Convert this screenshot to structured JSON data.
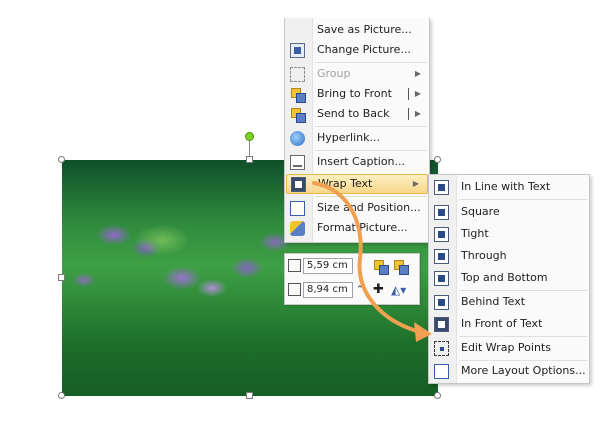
{
  "context_menu": {
    "items": [
      {
        "label": "Save as Picture...",
        "icon": "save-icon",
        "disabled": false
      },
      {
        "label": "Change Picture...",
        "icon": "change-picture-icon",
        "disabled": false
      },
      {
        "label": "Group",
        "icon": "group-icon",
        "disabled": true
      },
      {
        "label": "Bring to Front",
        "icon": "bring-to-front-icon",
        "disabled": false
      },
      {
        "label": "Send to Back",
        "icon": "send-to-back-icon",
        "disabled": false
      },
      {
        "label": "Hyperlink...",
        "icon": "hyperlink-icon",
        "disabled": false
      },
      {
        "label": "Insert Caption...",
        "icon": "caption-icon",
        "disabled": false
      },
      {
        "label": "Wrap Text",
        "icon": "wrap-text-icon",
        "disabled": false,
        "highlighted": true
      },
      {
        "label": "Size and Position...",
        "icon": "size-position-icon",
        "disabled": false
      },
      {
        "label": "Format Picture...",
        "icon": "format-picture-icon",
        "disabled": false
      }
    ]
  },
  "wrap_submenu": {
    "items": [
      {
        "label": "In Line with Text",
        "icon": "inline-wrap-icon"
      },
      {
        "label": "Square",
        "icon": "square-wrap-icon"
      },
      {
        "label": "Tight",
        "icon": "tight-wrap-icon"
      },
      {
        "label": "Through",
        "icon": "through-wrap-icon"
      },
      {
        "label": "Top and Bottom",
        "icon": "top-bottom-wrap-icon"
      },
      {
        "label": "Behind Text",
        "icon": "behind-text-icon"
      },
      {
        "label": "In Front of Text",
        "icon": "in-front-of-text-icon"
      },
      {
        "label": "Edit Wrap Points",
        "icon": "edit-wrap-points-icon"
      },
      {
        "label": "More Layout Options...",
        "icon": "layout-options-icon"
      }
    ]
  },
  "mini_toolbar": {
    "height_value": "5,59 cm",
    "width_value": "8,94 cm",
    "spin_glyph": "⌃"
  },
  "colors": {
    "highlight": "#f9d78a",
    "callout_arrow": "#f0a050",
    "rotate_handle": "#7ed321"
  }
}
